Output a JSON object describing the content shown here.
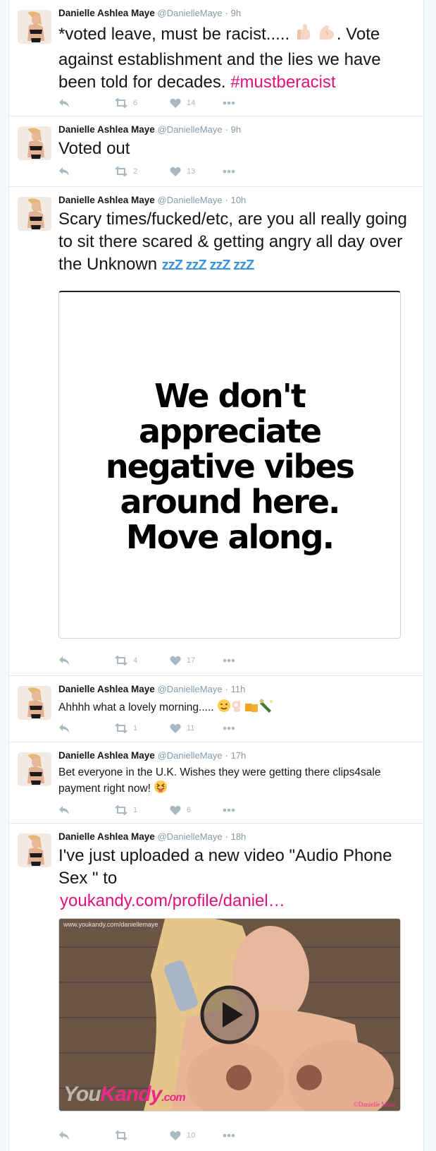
{
  "author": {
    "name": "Danielle Ashlea Maye",
    "handle": "@DanielleMaye"
  },
  "tweets": [
    {
      "time": "9h",
      "text_a": "*voted leave, must be racist.....",
      "text_b": "Vote against establishment and the lies we have been told for decades.",
      "hashtag": "#mustberacist",
      "retweets": "6",
      "likes": "14"
    },
    {
      "time": "9h",
      "text": "Voted out",
      "retweets": "2",
      "likes": "13"
    },
    {
      "time": "10h",
      "text": "Scary times/fucked/etc, are you all really going to sit there scared & getting angry all day over the Unknown",
      "zz": "zzZ zzZ zzZ zzZ",
      "image_text_1": "We don't",
      "image_text_2": "appreciate",
      "image_text_3": "negative vibes",
      "image_text_4": "around here.",
      "image_text_5": "Move along.",
      "retweets": "4",
      "likes": "17"
    },
    {
      "time": "11h",
      "text": "Ahhhh what a lovely morning.....",
      "retweets": "1",
      "likes": "11"
    },
    {
      "time": "17h",
      "text": "Bet everyone in the U.K. Wishes they were getting there clips4sale payment right now!",
      "retweets": "1",
      "likes": "6"
    },
    {
      "time": "18h",
      "text": "I've just uploaded a new video \"Audio Phone Sex \" to",
      "link": "youkandy.com/profile/daniel…",
      "video_url": "www.youkandy.com/daniellemaye",
      "brand_you": "You",
      "brand_kandy": "Kandy",
      "brand_com": ".com",
      "credit": "©Danielle Maye",
      "retweets": "",
      "likes": "10"
    }
  ],
  "icons": [
    "reply-icon",
    "retweet-icon",
    "like-icon",
    "more-icon",
    "play-icon"
  ],
  "colors": {
    "hashtag": "#e0117d",
    "meta": "#8899a6",
    "action": "#aab8c2",
    "zz": "#3b94d9"
  }
}
